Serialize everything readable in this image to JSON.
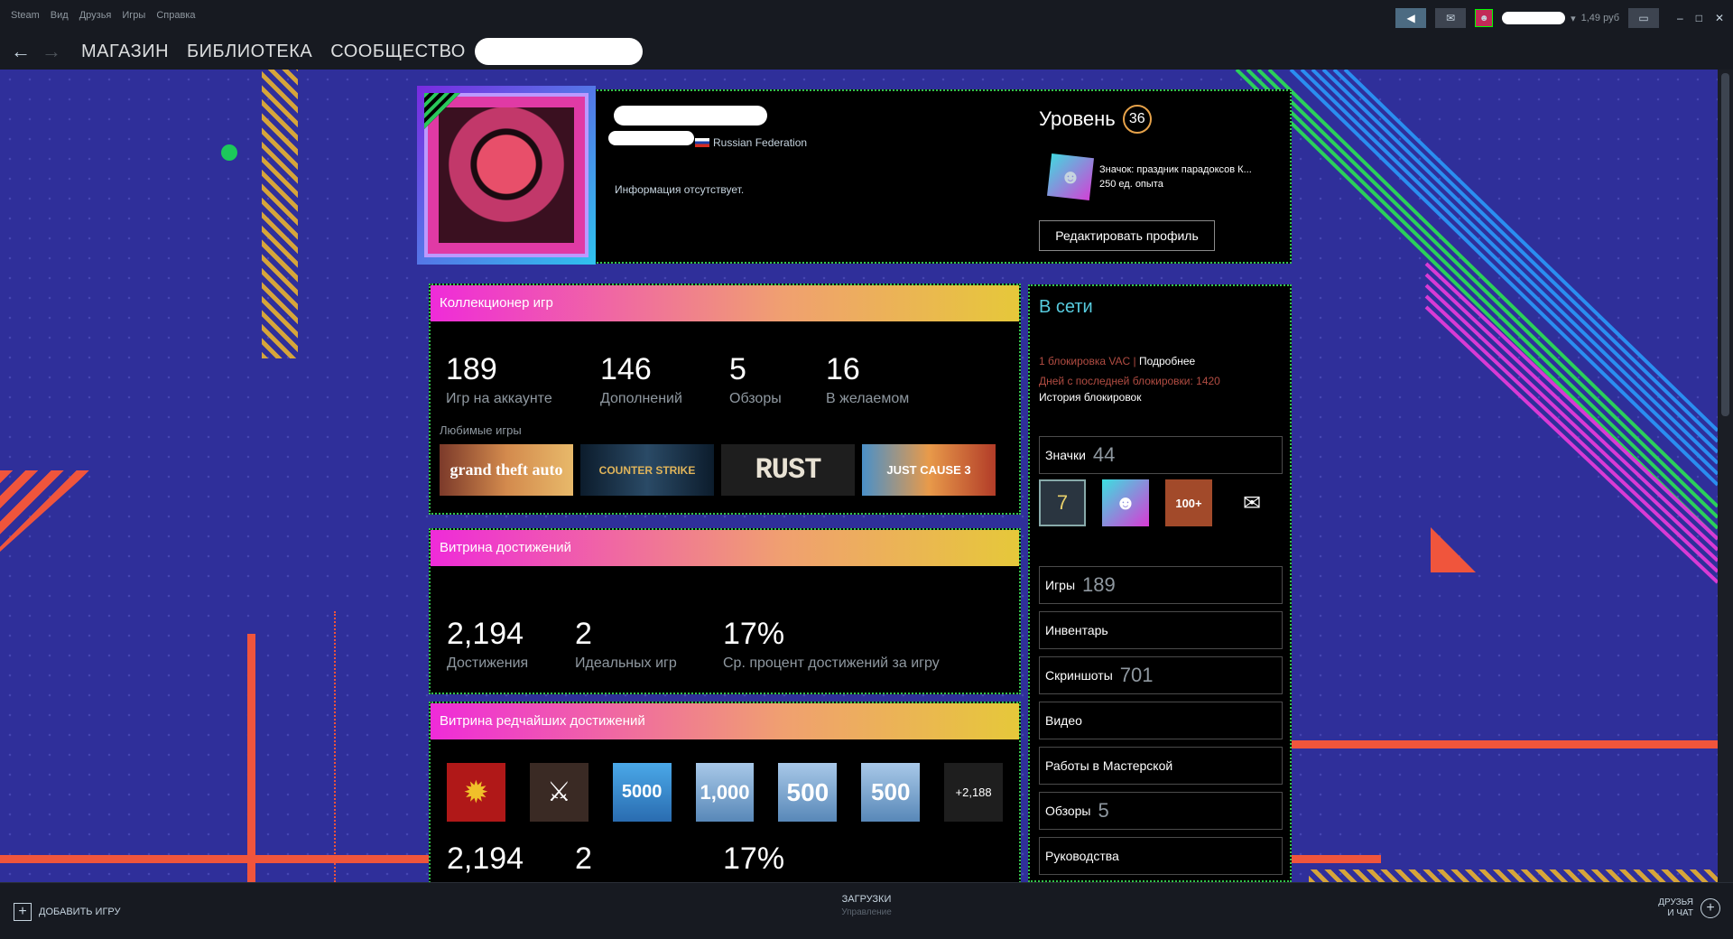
{
  "titlebar": {
    "menu": [
      "Steam",
      "Вид",
      "Друзья",
      "Игры",
      "Справка"
    ],
    "balance": "1,49 руб"
  },
  "nav": {
    "store": "МАГАЗИН",
    "library": "БИБЛИОТЕКА",
    "community": "СООБЩЕСТВО"
  },
  "profile": {
    "country": "Russian Federation",
    "summary": "Информация отсутствует.",
    "level_label": "Уровень",
    "level": "36",
    "favorite_badge_name": "Значок: праздник парадоксов К...",
    "favorite_badge_xp": "250 ед. опыта",
    "edit_button": "Редактировать профиль"
  },
  "game_collector": {
    "title": "Коллекционер игр",
    "stats": [
      {
        "value": "189",
        "label": "Игр на аккаунте"
      },
      {
        "value": "146",
        "label": "Дополнений"
      },
      {
        "value": "5",
        "label": "Обзоры"
      },
      {
        "value": "16",
        "label": "В желаемом"
      }
    ],
    "favorites_label": "Любимые игры",
    "games": [
      {
        "name": "GTA V",
        "text": "grand theft auto"
      },
      {
        "name": "Counter-Strike",
        "text": "COUNTER STRIKE"
      },
      {
        "name": "Rust",
        "text": "RUST"
      },
      {
        "name": "Just Cause 3",
        "text": "JUST CAUSE 3"
      }
    ]
  },
  "achievement_showcase": {
    "title": "Витрина достижений",
    "stats": [
      {
        "value": "2,194",
        "label": "Достижения"
      },
      {
        "value": "2",
        "label": "Идеальных игр"
      },
      {
        "value": "17%",
        "label": "Ср. процент достижений за игру"
      }
    ]
  },
  "rare_achievements": {
    "title": "Витрина редчайших достижений",
    "icons": [
      "✹",
      "⚔",
      "5000",
      "1,000",
      "500",
      "500"
    ],
    "more": "+2,188",
    "stats": [
      {
        "value": "2,194"
      },
      {
        "value": "2"
      },
      {
        "value": "17%"
      }
    ]
  },
  "sidebar": {
    "status": "В сети",
    "vac_line": "1 блокировка VAC |",
    "vac_link": "Подробнее",
    "days_since": "Дней с последней блокировки: 1420",
    "ban_history": "История блокировок",
    "badges": {
      "label": "Значки",
      "count": "44",
      "icons": [
        "7",
        "☻",
        "100+",
        "✉"
      ]
    },
    "items": [
      {
        "label": "Игры",
        "count": "189"
      },
      {
        "label": "Инвентарь",
        "count": ""
      },
      {
        "label": "Скриншоты",
        "count": "701"
      },
      {
        "label": "Видео",
        "count": ""
      },
      {
        "label": "Работы в Мастерской",
        "count": ""
      },
      {
        "label": "Обзоры",
        "count": "5"
      },
      {
        "label": "Руководства",
        "count": ""
      }
    ]
  },
  "bottombar": {
    "add_game": "ДОБАВИТЬ ИГРУ",
    "downloads": "ЗАГРУЗКИ",
    "downloads_sub": "Управление",
    "friends_line1": "ДРУЗЬЯ",
    "friends_line2": "И ЧАТ"
  }
}
